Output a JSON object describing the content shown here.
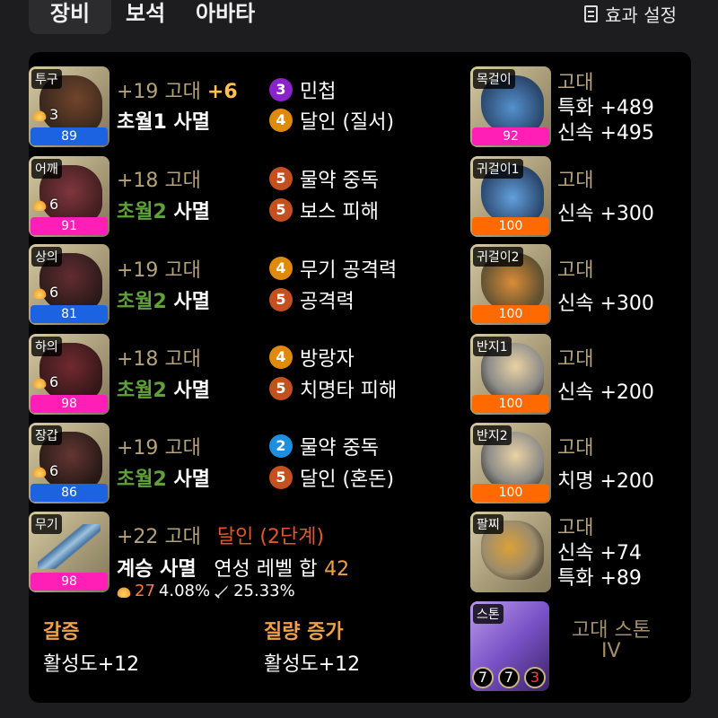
{
  "tabs": [
    {
      "label": "장비",
      "active": true
    },
    {
      "label": "보석",
      "active": false
    },
    {
      "label": "아바타",
      "active": false
    }
  ],
  "effects_label": "효과 설정",
  "equipment": [
    {
      "slot": "투구",
      "level": "3",
      "quality": "89",
      "bar_color": "blue",
      "upgrade": "+19",
      "grade": "고대",
      "extra": "+6",
      "set_prefix": "초월1",
      "set_name": "사멸",
      "engravings": [
        {
          "num": "3",
          "name": "민첩",
          "color": "purple"
        },
        {
          "num": "4",
          "name": "달인 (질서)",
          "color": "orange"
        }
      ]
    },
    {
      "slot": "어깨",
      "level": "6",
      "quality": "91",
      "bar_color": "pink",
      "upgrade": "+18",
      "grade": "고대",
      "extra": "",
      "set_prefix": "초월2",
      "set_name": "사멸",
      "engravings": [
        {
          "num": "5",
          "name": "물약 중독",
          "color": "red"
        },
        {
          "num": "5",
          "name": "보스 피해",
          "color": "red"
        }
      ]
    },
    {
      "slot": "상의",
      "level": "6",
      "quality": "81",
      "bar_color": "blue",
      "upgrade": "+19",
      "grade": "고대",
      "extra": "",
      "set_prefix": "초월2",
      "set_name": "사멸",
      "engravings": [
        {
          "num": "4",
          "name": "무기 공격력",
          "color": "orange"
        },
        {
          "num": "5",
          "name": "공격력",
          "color": "red"
        }
      ]
    },
    {
      "slot": "하의",
      "level": "6",
      "quality": "98",
      "bar_color": "pink",
      "upgrade": "+18",
      "grade": "고대",
      "extra": "",
      "set_prefix": "초월2",
      "set_name": "사멸",
      "engravings": [
        {
          "num": "4",
          "name": "방랑자",
          "color": "orange"
        },
        {
          "num": "5",
          "name": "치명타 피해",
          "color": "red"
        }
      ]
    },
    {
      "slot": "장갑",
      "level": "6",
      "quality": "86",
      "bar_color": "blue",
      "upgrade": "+19",
      "grade": "고대",
      "extra": "",
      "set_prefix": "초월2",
      "set_name": "사멸",
      "engravings": [
        {
          "num": "2",
          "name": "물약 중독",
          "color": "blue"
        },
        {
          "num": "5",
          "name": "달인 (혼돈)",
          "color": "red"
        }
      ]
    }
  ],
  "weapon": {
    "slot": "무기",
    "quality": "98",
    "upgrade": "+22",
    "grade": "고대",
    "stage": "달인 (2단계)",
    "line2_prefix": "계승",
    "line2_name": "사멸",
    "refine_label": "연성 레벨 합",
    "refine_value": "42",
    "flame_value": "27",
    "flame_pct": "4.08%",
    "sword_pct": "25.33%"
  },
  "sections": [
    {
      "title": "갈증",
      "value": "활성도+12"
    },
    {
      "title": "질량 증가",
      "value": "활성도+12"
    }
  ],
  "accessories": [
    {
      "slot": "목걸이",
      "quality": "92",
      "bar_color": "pink",
      "grade": "고대",
      "stats": [
        "특화 +489",
        "신속 +495"
      ]
    },
    {
      "slot": "귀걸이1",
      "quality": "100",
      "bar_color": "orange",
      "grade": "고대",
      "stats": [
        "신속 +300"
      ]
    },
    {
      "slot": "귀걸이2",
      "quality": "100",
      "bar_color": "orange",
      "grade": "고대",
      "stats": [
        "신속 +300"
      ]
    },
    {
      "slot": "반지1",
      "quality": "100",
      "bar_color": "orange",
      "grade": "고대",
      "stats": [
        "신속 +200"
      ]
    },
    {
      "slot": "반지2",
      "quality": "100",
      "bar_color": "orange",
      "grade": "고대",
      "stats": [
        "치명 +200"
      ]
    },
    {
      "slot": "팔찌",
      "grade": "고대",
      "stats": [
        "신속 +74",
        "특화 +89"
      ]
    }
  ],
  "stone": {
    "slot": "스톤",
    "badges": [
      "7",
      "7",
      "3"
    ],
    "name": "고대 스톤",
    "tier": "IV"
  }
}
